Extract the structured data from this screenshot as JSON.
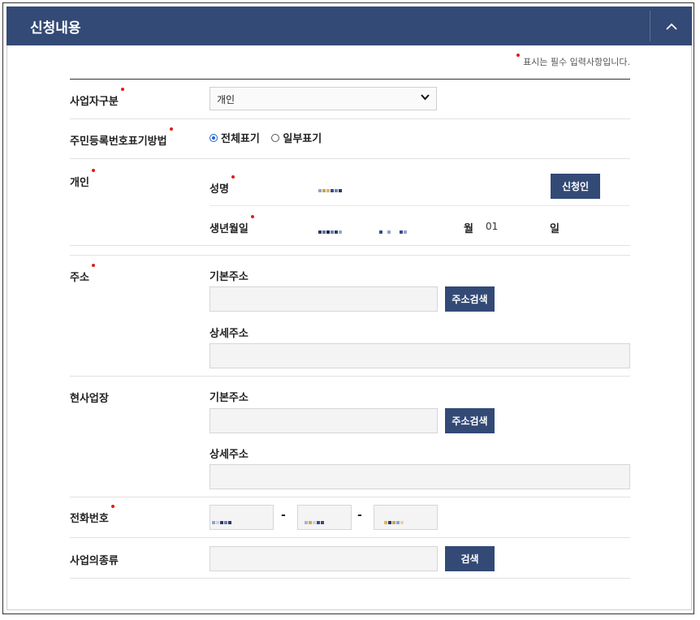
{
  "header": {
    "title": "신청내용"
  },
  "required_note": "표시는 필수 입력사항입니다.",
  "business_type": {
    "label": "사업자구분",
    "value": "개인"
  },
  "id_display": {
    "label": "주민등록번호표기방법",
    "options": [
      {
        "label": "전체표기",
        "selected": true
      },
      {
        "label": "일부표기",
        "selected": false
      }
    ]
  },
  "individual": {
    "label": "개인",
    "name_label": "성명",
    "applicant_button": "신청인",
    "dob_label": "생년월일",
    "month_unit": "월",
    "day_value": "01",
    "day_unit": "일"
  },
  "address": {
    "label": "주소",
    "basic_label": "기본주소",
    "search_button": "주소검색",
    "detail_label": "상세주소"
  },
  "worksite": {
    "label": "현사업장",
    "basic_label": "기본주소",
    "search_button": "주소검색",
    "detail_label": "상세주소"
  },
  "phone": {
    "label": "전화번호",
    "separator": "-"
  },
  "business_kind": {
    "label": "사업의종류",
    "search_button": "검색"
  },
  "colors": {
    "header_bg": "#334a76",
    "button_bg": "#334a76",
    "required_dot": "#e21b1b"
  },
  "icons": {
    "collapse": "chevron-up-icon",
    "select": "chevron-down-icon"
  }
}
